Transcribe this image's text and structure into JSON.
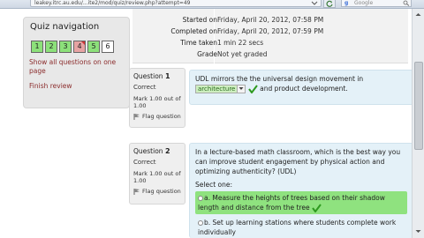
{
  "browser": {
    "url": "leakey.itrc.au.edu/...ite2/mod/quiz/review.php?attempt=49",
    "search_placeholder": "Google"
  },
  "nav": {
    "title": "Quiz navigation",
    "buttons": [
      {
        "label": "1",
        "state": "correct"
      },
      {
        "label": "2",
        "state": "correct"
      },
      {
        "label": "3",
        "state": "correct"
      },
      {
        "label": "4",
        "state": "wrong"
      },
      {
        "label": "5",
        "state": "correct"
      },
      {
        "label": "6",
        "state": "none"
      }
    ],
    "show_all": "Show all questions on one page",
    "finish": "Finish review"
  },
  "summary": {
    "rows": [
      {
        "label": "Started on",
        "value": "Friday, April 20, 2012, 07:58 PM"
      },
      {
        "label": "Completed on",
        "value": "Friday, April 20, 2012, 07:59 PM"
      },
      {
        "label": "Time taken",
        "value": "1 min 22 secs"
      },
      {
        "label": "Grade",
        "value": "Not yet graded"
      }
    ]
  },
  "questions": [
    {
      "label": "Question",
      "number": "1",
      "state": "Correct",
      "mark": "Mark 1.00 out of 1.00",
      "flag": "Flag question",
      "text_before": "UDL mirrors the the universal design movement in",
      "selected": "architecture",
      "text_after": "and product development."
    },
    {
      "label": "Question",
      "number": "2",
      "state": "Correct",
      "mark": "Mark 1.00 out of 1.00",
      "flag": "Flag question",
      "text": "In a lecture-based math classroom, which is the best way you can improve student engagement by physical action and optimizing authenticity? (UDL)",
      "select_one": "Select one:",
      "answer_a": "a. Measure the heights of trees based on their shadow length and distance from the tree",
      "answer_b": "b. Set up learning stations where students complete work individually"
    }
  ],
  "colors": {
    "correct": "#8ce07a",
    "wrong": "#e7a3a3",
    "link": "#8b2c2c",
    "content_bg": "#e4f1f8"
  }
}
